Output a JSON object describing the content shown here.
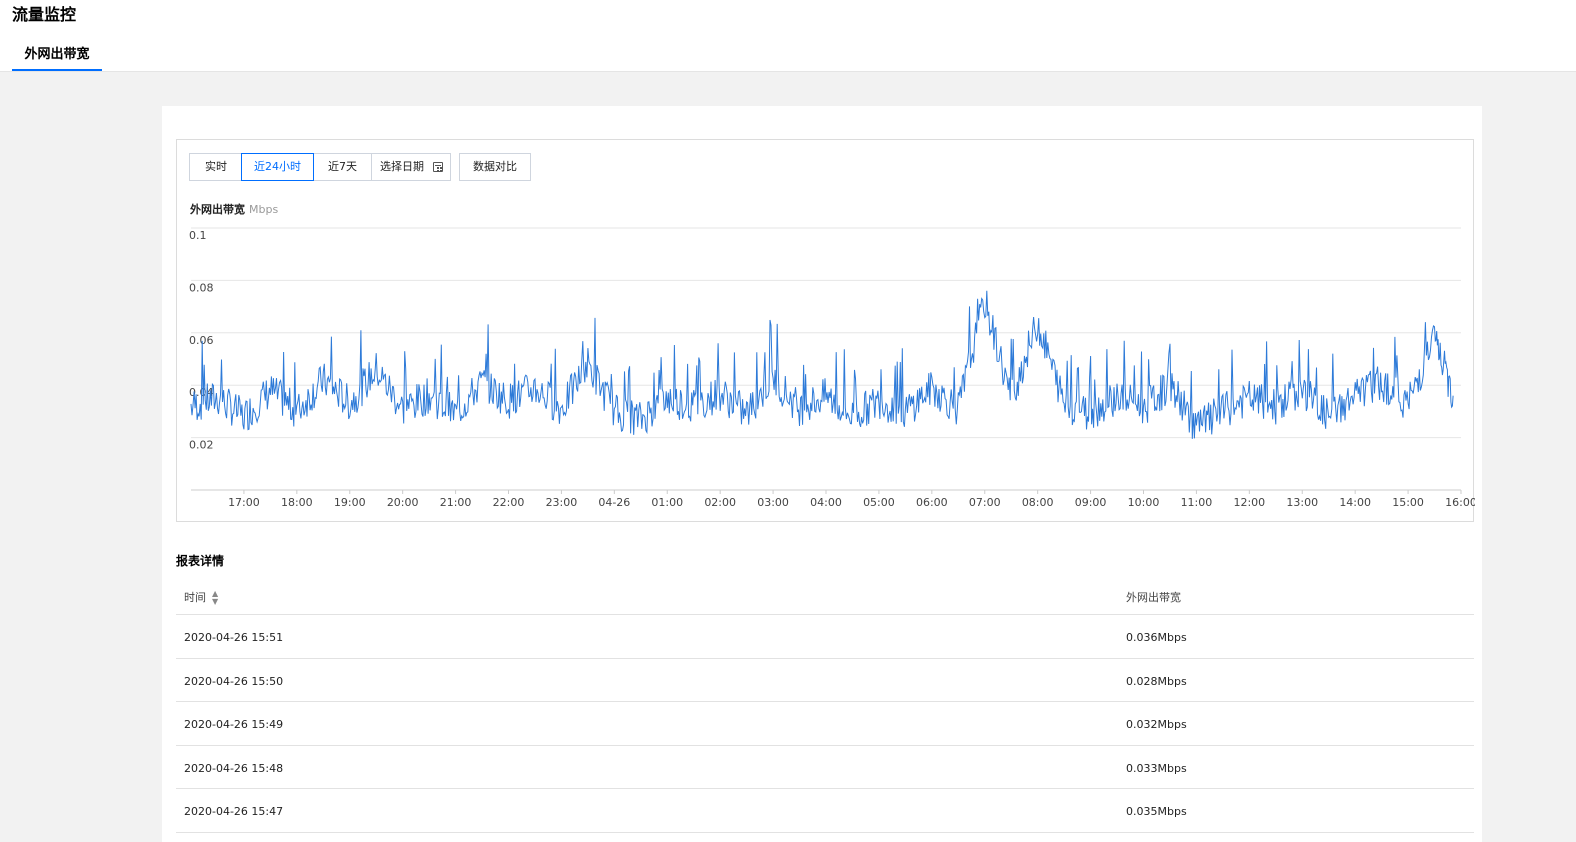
{
  "header": {
    "title": "流量监控",
    "tab": "外网出带宽"
  },
  "toolbar": {
    "realtime": "实时",
    "last24h": "近24小时",
    "last7d": "近7天",
    "pick_date": "选择日期",
    "compare": "数据对比"
  },
  "chart": {
    "title": "外网出带宽",
    "unit": "Mbps"
  },
  "chart_data": {
    "type": "line",
    "title": "外网出带宽",
    "ylabel": "Mbps",
    "ylim": [
      0,
      0.1
    ],
    "yticks": [
      "0.1",
      "0.08",
      "0.06",
      "0.04",
      "0.02"
    ],
    "xlim": [
      "2020-04-25 16:00",
      "2020-04-26 16:00"
    ],
    "xticks": [
      "17:00",
      "18:00",
      "19:00",
      "20:00",
      "21:00",
      "22:00",
      "23:00",
      "04-26",
      "01:00",
      "02:00",
      "03:00",
      "04:00",
      "05:00",
      "06:00",
      "07:00",
      "08:00",
      "09:00",
      "10:00",
      "11:00",
      "12:00",
      "13:00",
      "14:00",
      "15:00",
      "16:00"
    ],
    "grid": true,
    "series": [
      {
        "color": "#2d7ad8",
        "x": [
          "2020-04-25 16:00",
          "2020-04-25 16:30",
          "2020-04-25 17:00",
          "2020-04-25 17:30",
          "2020-04-25 18:00",
          "2020-04-25 18:30",
          "2020-04-25 19:00",
          "2020-04-25 19:30",
          "2020-04-25 20:00",
          "2020-04-25 20:30",
          "2020-04-25 21:00",
          "2020-04-25 21:30",
          "2020-04-25 22:00",
          "2020-04-25 22:30",
          "2020-04-25 23:00",
          "2020-04-25 23:30",
          "2020-04-26 00:00",
          "2020-04-26 00:30",
          "2020-04-26 01:00",
          "2020-04-26 01:30",
          "2020-04-26 02:00",
          "2020-04-26 02:30",
          "2020-04-26 03:00",
          "2020-04-26 03:30",
          "2020-04-26 04:00",
          "2020-04-26 04:30",
          "2020-04-26 05:00",
          "2020-04-26 05:30",
          "2020-04-26 06:00",
          "2020-04-26 06:30",
          "2020-04-26 07:00",
          "2020-04-26 07:30",
          "2020-04-26 08:00",
          "2020-04-26 08:30",
          "2020-04-26 09:00",
          "2020-04-26 09:30",
          "2020-04-26 10:00",
          "2020-04-26 10:30",
          "2020-04-26 11:00",
          "2020-04-26 11:30",
          "2020-04-26 12:00",
          "2020-04-26 12:30",
          "2020-04-26 13:00",
          "2020-04-26 13:30",
          "2020-04-26 14:00",
          "2020-04-26 14:30",
          "2020-04-26 15:00",
          "2020-04-26 15:30",
          "2020-04-26 15:51"
        ],
        "y": [
          0.032,
          0.035,
          0.028,
          0.038,
          0.03,
          0.042,
          0.033,
          0.046,
          0.031,
          0.036,
          0.029,
          0.041,
          0.034,
          0.039,
          0.031,
          0.048,
          0.03,
          0.027,
          0.035,
          0.032,
          0.037,
          0.029,
          0.043,
          0.031,
          0.036,
          0.028,
          0.034,
          0.03,
          0.039,
          0.031,
          0.072,
          0.035,
          0.064,
          0.033,
          0.029,
          0.036,
          0.031,
          0.04,
          0.024,
          0.03,
          0.035,
          0.032,
          0.038,
          0.028,
          0.036,
          0.041,
          0.033,
          0.058,
          0.036
        ]
      }
    ]
  },
  "report": {
    "title": "报表详情",
    "col_time": "时间",
    "col_value": "外网出带宽",
    "rows": [
      {
        "time": "2020-04-26 15:51",
        "value": "0.036Mbps"
      },
      {
        "time": "2020-04-26 15:50",
        "value": "0.028Mbps"
      },
      {
        "time": "2020-04-26 15:49",
        "value": "0.032Mbps"
      },
      {
        "time": "2020-04-26 15:48",
        "value": "0.033Mbps"
      },
      {
        "time": "2020-04-26 15:47",
        "value": "0.035Mbps"
      }
    ]
  }
}
